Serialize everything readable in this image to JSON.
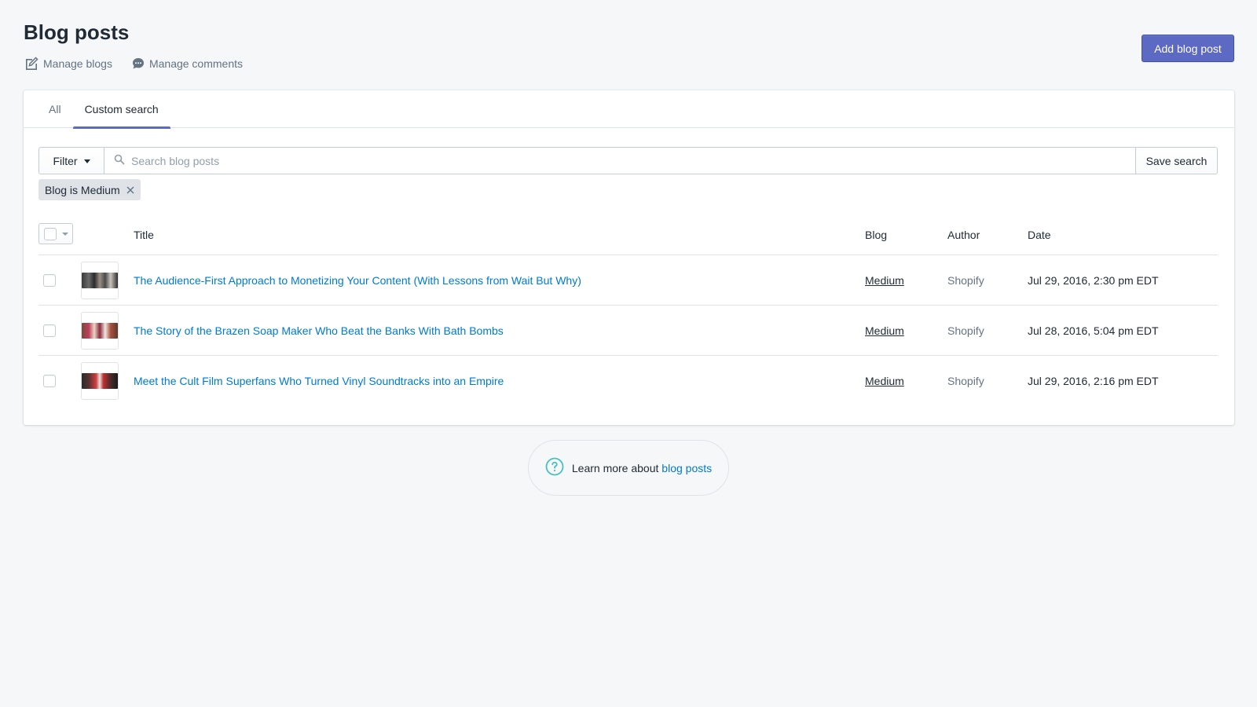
{
  "page": {
    "title": "Blog posts",
    "secondary_actions": [
      {
        "label": "Manage blogs",
        "icon": "edit-icon"
      },
      {
        "label": "Manage comments",
        "icon": "comment-icon"
      }
    ],
    "primary_action": "Add blog post"
  },
  "tabs": [
    {
      "label": "All",
      "active": false
    },
    {
      "label": "Custom search",
      "active": true
    }
  ],
  "filter": {
    "button_label": "Filter",
    "search_placeholder": "Search blog posts",
    "search_value": "",
    "save_label": "Save search",
    "applied_tag": "Blog is Medium"
  },
  "table": {
    "headers": {
      "title": "Title",
      "blog": "Blog",
      "author": "Author",
      "date": "Date"
    },
    "rows": [
      {
        "title": "The Audience-First Approach to Monetizing Your Content (With Lessons from Wait But Why)",
        "blog": "Medium",
        "author": "Shopify",
        "date": "Jul 29, 2016, 2:30 pm EDT"
      },
      {
        "title": "The Story of the Brazen Soap Maker Who Beat the Banks With Bath Bombs",
        "blog": "Medium",
        "author": "Shopify",
        "date": "Jul 28, 2016, 5:04 pm EDT"
      },
      {
        "title": "Meet the Cult Film Superfans Who Turned Vinyl Soundtracks into an Empire",
        "blog": "Medium",
        "author": "Shopify",
        "date": "Jul 29, 2016, 2:16 pm EDT"
      }
    ]
  },
  "footer": {
    "text": "Learn more about",
    "link": "blog posts"
  },
  "colors": {
    "primary": "#5c6ac4",
    "link": "#007ace",
    "help_icon": "#47c1bf",
    "background": "#f6f7f9"
  }
}
